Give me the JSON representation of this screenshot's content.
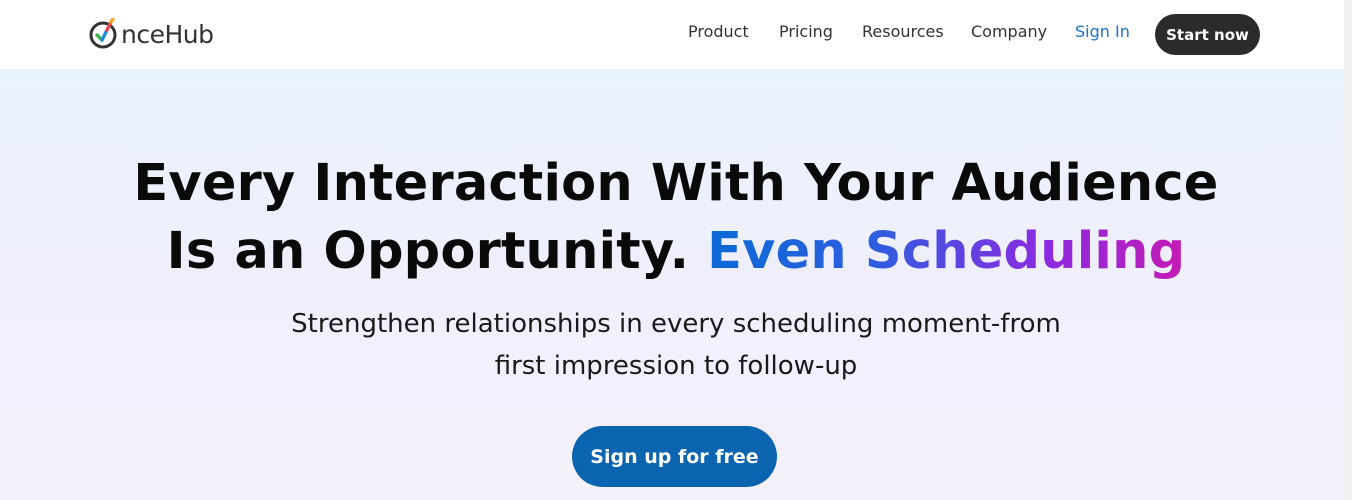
{
  "brand": {
    "logo_text": "nceHub",
    "logo_icon": "checkmark-o-icon",
    "colors": {
      "check_blue": "#1f8ae0",
      "check_green": "#3cb54a",
      "check_orange": "#f5a623",
      "check_red": "#e8474c"
    }
  },
  "nav": {
    "items": [
      {
        "label": "Product"
      },
      {
        "label": "Pricing"
      },
      {
        "label": "Resources"
      },
      {
        "label": "Company"
      }
    ],
    "sign_in": "Sign In",
    "start_now": "Start now"
  },
  "hero": {
    "title_line1": "Every Interaction With Your Audience",
    "title_line2_plain": "Is an Opportunity.",
    "title_line2_highlight": "Even Scheduling",
    "subtitle_line1": "Strengthen relationships in every scheduling moment-from",
    "subtitle_line2": "first impression to follow-up",
    "cta_label": "Sign up for free"
  },
  "colors": {
    "accent_blue": "#0b64b0",
    "signin_blue": "#1a73c9",
    "dark_button": "#2b2b2b",
    "gradient_start": "#0b6ad6",
    "gradient_end": "#c51bb3"
  }
}
